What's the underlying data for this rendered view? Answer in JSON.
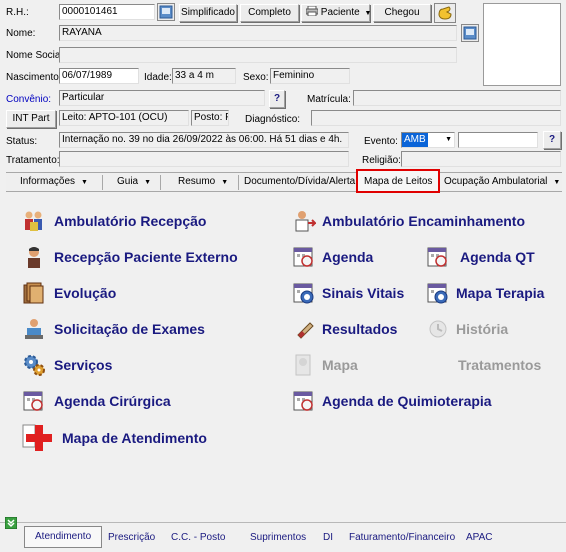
{
  "header": {
    "rh_label": "R.H.:",
    "rh_value": "0000101461",
    "btn_simplificado": "Simplificado",
    "btn_completo": "Completo",
    "btn_paciente": "Paciente",
    "btn_chegou": "Chegou",
    "nome_label": "Nome:",
    "nome_value": "RAYANA",
    "nome_social_label": "Nome Social:",
    "nascimento_label": "Nascimento:",
    "nascimento_value": "06/07/1989",
    "idade_label": "Idade:",
    "idade_value": "33 a 4 m",
    "sexo_label": "Sexo:",
    "sexo_value": "Feminino",
    "convenio_label": "Convênio:",
    "convenio_value": "Particular",
    "matricula_label": "Matrícula:",
    "int_part_button": "INT Part",
    "leito_value": "Leito: APTO-101 (OCU)",
    "posto_value": "Posto: POS",
    "diagnostico_label": "Diagnóstico:",
    "status_label": "Status:",
    "status_value": "Internação no. 39 no dia 26/09/2022  às  06:00. Há 51 dias e 4h.",
    "evento_label": "Evento:",
    "evento_value": "AMB",
    "religiao_label": "Religião:",
    "tratamento_label": "Tratamento:",
    "help_glyph": "?"
  },
  "tabs": [
    {
      "label": "Informações",
      "has_arrow": true
    },
    {
      "label": "Guia",
      "has_arrow": true
    },
    {
      "label": "Resumo",
      "has_arrow": true
    },
    {
      "label": "Documento/Dívida/Alerta",
      "has_arrow": false
    },
    {
      "label": "Mapa de Leitos",
      "has_arrow": false,
      "highlighted": true
    },
    {
      "label": "Ocupação Ambulatorial",
      "has_arrow": true
    }
  ],
  "actions": {
    "ambulatorio_recepcao": "Ambulatório Recepção",
    "ambulatorio_encaminhamento": "Ambulatório Encaminhamento",
    "recepcao_paciente_externo": "Recepção Paciente Externo",
    "agenda": "Agenda",
    "agenda_qt": "Agenda QT",
    "evolucao": "Evolução",
    "sinais_vitais": "Sinais Vitais",
    "mapa_terapia": "Mapa Terapia",
    "solicitacao_exames": "Solicitação de Exames",
    "resultados": "Resultados",
    "historia": "História",
    "servicos": "Serviços",
    "mapa": "Mapa",
    "tratamentos": "Tratamentos",
    "agenda_cirurgica": "Agenda Cirúrgica",
    "agenda_quimioterapia": "Agenda de Quimioterapia",
    "mapa_atendimento": "Mapa de Atendimento"
  },
  "bottom_tabs": [
    "Atendimento",
    "Prescrição",
    "C.C. - Posto",
    "Suprimentos",
    "DI",
    "Faturamento/Financeiro",
    "APAC"
  ],
  "colors": {
    "accent_red": "#e00000",
    "link_blue": "#1a1a80",
    "disabled": "#9a9a9a",
    "selection": "#0a64d8"
  }
}
